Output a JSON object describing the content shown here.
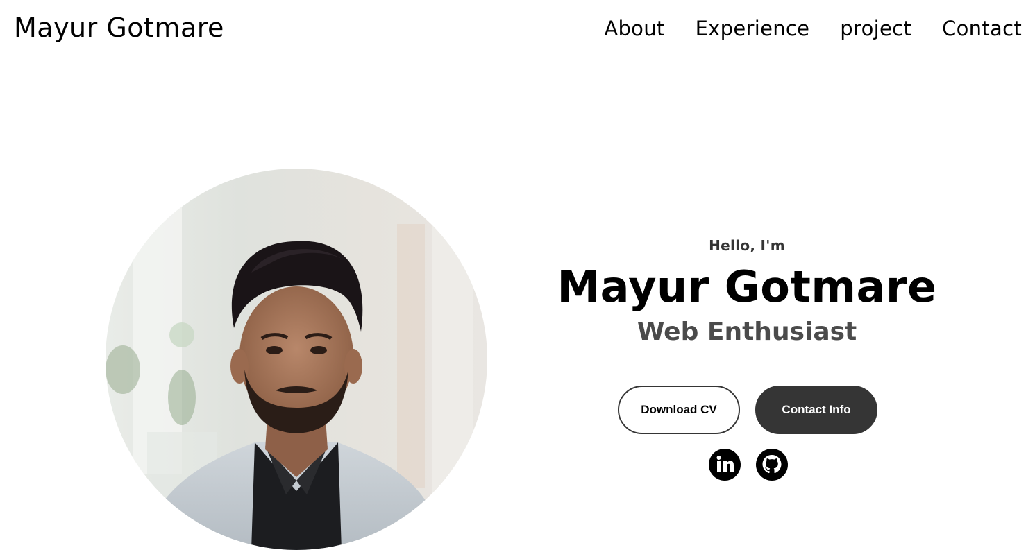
{
  "nav": {
    "logo": "Mayur Gotmare",
    "links": [
      "About",
      "Experience",
      "project",
      "Contact"
    ]
  },
  "hero": {
    "greeting": "Hello, I'm",
    "name": "Mayur Gotmare",
    "tagline": "Web Enthusiast",
    "buttons": {
      "download_cv": "Download CV",
      "contact_info": "Contact Info"
    },
    "socials": [
      {
        "icon": "linkedin-icon"
      },
      {
        "icon": "github-icon"
      }
    ]
  },
  "colors": {
    "text": "#000000",
    "secondary_text": "#353535",
    "tagline": "#4b4b4b",
    "button_dark": "#353535",
    "background": "#ffffff"
  }
}
